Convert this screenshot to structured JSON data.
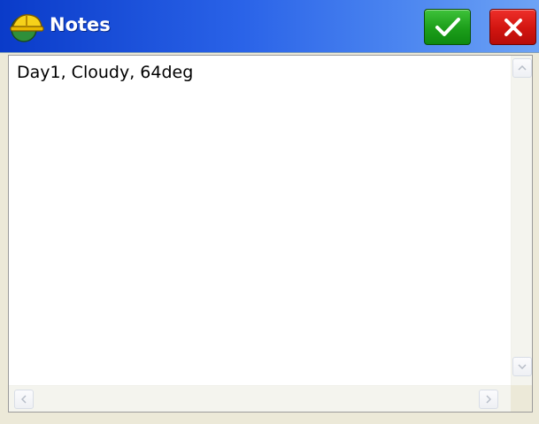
{
  "window": {
    "title": "Notes",
    "app_icon": "hardhat-globe-icon",
    "ok_icon": "checkmark-icon",
    "cancel_icon": "close-icon"
  },
  "notes": {
    "text": "Day1, Cloudy, 64deg"
  },
  "colors": {
    "titlebar_start": "#0a3bc9",
    "titlebar_end": "#6ea3f5",
    "ok_green": "#1c9e1a",
    "cancel_red": "#d11510"
  }
}
